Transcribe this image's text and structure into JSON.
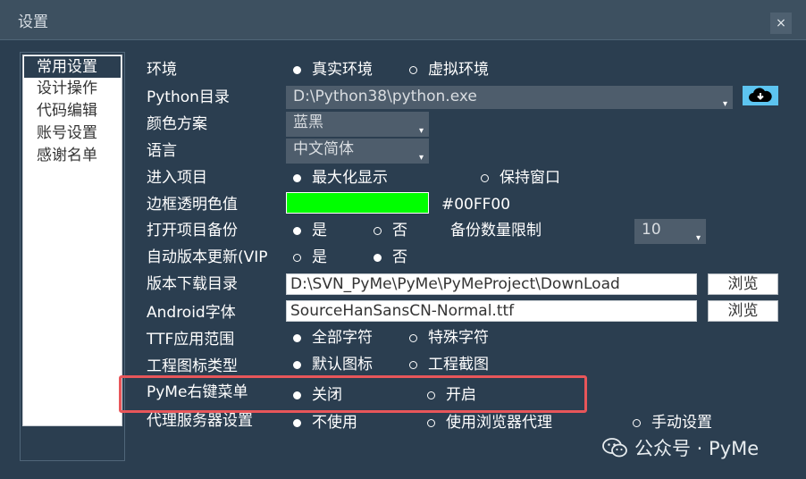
{
  "window": {
    "title": "设置",
    "close": "×"
  },
  "nav": {
    "items": [
      "常用设置",
      "设计操作",
      "代码编辑",
      "账号设置",
      "感谢名单"
    ]
  },
  "settings": {
    "env": {
      "label": "环境",
      "options": [
        "真实环境",
        "虚拟环境"
      ]
    },
    "python": {
      "label": "Python目录",
      "value": "D:\\Python38\\python.exe"
    },
    "color_scheme": {
      "label": "颜色方案",
      "value": "蓝黑"
    },
    "language": {
      "label": "语言",
      "value": "中文简体"
    },
    "enter_project": {
      "label": "进入项目",
      "options": [
        "最大化显示",
        "保持窗口"
      ]
    },
    "border_color": {
      "label": "边框透明色值",
      "value": "#00FF00"
    },
    "backup": {
      "label": "打开项目备份",
      "options": [
        "是",
        "否"
      ],
      "limit_label": "备份数量限制",
      "limit_value": "10"
    },
    "auto_update": {
      "label": "自动版本更新(VIP",
      "options": [
        "是",
        "否"
      ]
    },
    "download_dir": {
      "label": "版本下载目录",
      "value": "D:\\SVN_PyMe\\PyMe\\PyMeProject\\DownLoad",
      "browse": "浏览"
    },
    "android_font": {
      "label": "Android字体",
      "value": "SourceHanSansCN-Normal.ttf",
      "browse": "浏览"
    },
    "ttf_scope": {
      "label": "TTF应用范围",
      "options": [
        "全部字符",
        "特殊字符"
      ]
    },
    "project_icon": {
      "label": "工程图标类型",
      "options": [
        "默认图标",
        "工程截图"
      ]
    },
    "context_menu": {
      "label": "PyMe右键菜单",
      "options": [
        "关闭",
        "开启"
      ]
    },
    "proxy": {
      "label": "代理服务器设置",
      "options": [
        "不使用",
        "使用浏览器代理",
        "手动设置"
      ]
    }
  },
  "watermark": {
    "text": "公众号 · PyMe"
  },
  "colors": {
    "background": "#2b3e50",
    "highlight": "#e8565a",
    "swatch": "#00ff00",
    "accent": "#5dc4f0"
  }
}
